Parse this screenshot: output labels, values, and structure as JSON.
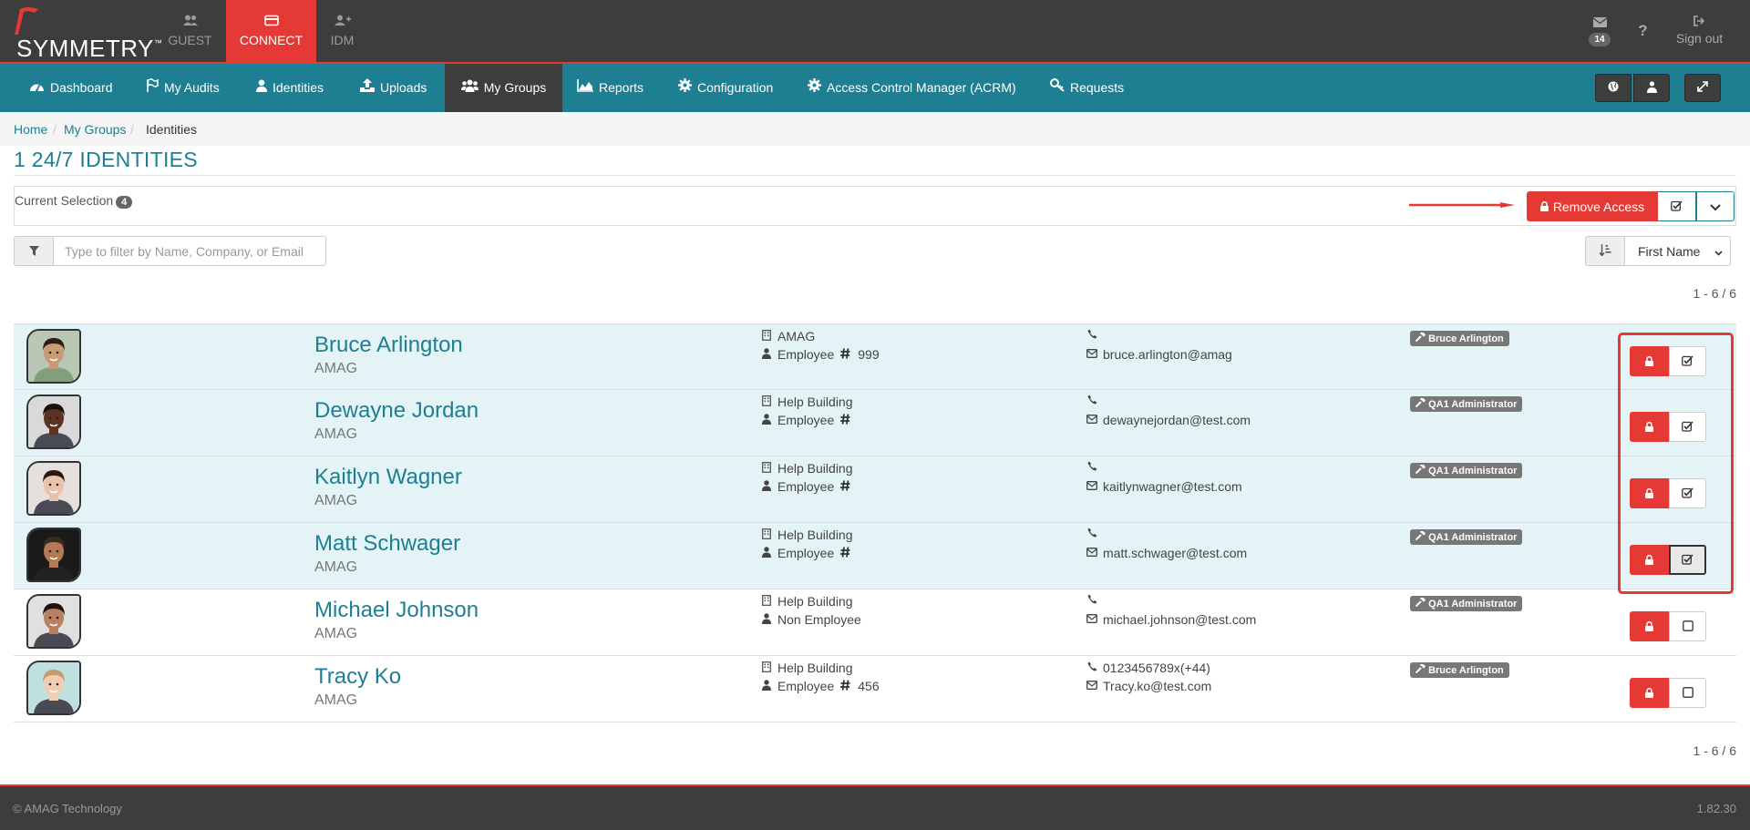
{
  "brand": {
    "name": "SYMMETRY",
    "trademark": "™"
  },
  "app_tabs": [
    {
      "label": "GUEST",
      "icon": "users-icon"
    },
    {
      "label": "CONNECT",
      "icon": "card-icon",
      "active": true
    },
    {
      "label": "IDM",
      "icon": "user-plus-icon"
    }
  ],
  "top_right": {
    "mail_count": "14",
    "help": "?",
    "sign_out": "Sign out"
  },
  "nav": [
    {
      "label": "Dashboard",
      "icon": "dashboard-icon"
    },
    {
      "label": "My Audits",
      "icon": "flag-icon"
    },
    {
      "label": "Identities",
      "icon": "user-icon"
    },
    {
      "label": "Uploads",
      "icon": "upload-icon"
    },
    {
      "label": "My Groups",
      "icon": "users-icon",
      "active": true
    },
    {
      "label": "Reports",
      "icon": "area-chart-icon"
    },
    {
      "label": "Configuration",
      "icon": "gear-icon"
    },
    {
      "label": "Access Control Manager (ACRM)",
      "icon": "gear-icon"
    },
    {
      "label": "Requests",
      "icon": "key-icon"
    }
  ],
  "breadcrumb": [
    "Home",
    "My Groups",
    "Identities"
  ],
  "page_title": "1 24/7 IDENTITIES",
  "selection": {
    "label": "Current Selection",
    "count": "4",
    "remove_label": "Remove Access"
  },
  "filter": {
    "placeholder": "Type to filter by Name, Company, or Email"
  },
  "sort": {
    "value": "First Name"
  },
  "pager": "1 - 6 / 6",
  "identities": [
    {
      "name": "Bruce Arlington",
      "company": "AMAG",
      "building": "AMAG",
      "employee_type": "Employee",
      "employee_no": "999",
      "phone": "",
      "email": "bruce.arlington@amag",
      "role": "Bruce Arlington",
      "selected": true,
      "skin": "#c89a76",
      "hair": "#2b1d14",
      "bg": "#b9c7b5"
    },
    {
      "name": "Dewayne Jordan",
      "company": "AMAG",
      "building": "Help Building",
      "employee_type": "Employee",
      "employee_no": "",
      "phone": "",
      "email": "dewaynejordan@test.com",
      "role": "QA1 Administrator",
      "selected": true,
      "skin": "#5a3420",
      "hair": "#1a100a",
      "bg": "#d9d9d9"
    },
    {
      "name": "Kaitlyn Wagner",
      "company": "AMAG",
      "building": "Help Building",
      "employee_type": "Employee",
      "employee_no": "",
      "phone": "",
      "email": "kaitlynwagner@test.com",
      "role": "QA1 Administrator",
      "selected": true,
      "skin": "#e8c2ad",
      "hair": "#2a1712",
      "bg": "#e6e0dc"
    },
    {
      "name": "Matt Schwager",
      "company": "AMAG",
      "building": "Help Building",
      "employee_type": "Employee",
      "employee_no": "",
      "phone": "",
      "email": "matt.schwager@test.com",
      "role": "QA1 Administrator",
      "selected": true,
      "pressed": true,
      "skin": "#b57a55",
      "hair": "#3a2a20",
      "bg": "#1a1a1a"
    },
    {
      "name": "Michael Johnson",
      "company": "AMAG",
      "building": "Help Building",
      "employee_type": "Non Employee",
      "employee_no": "",
      "phone": "",
      "email": "michael.johnson@test.com",
      "role": "QA1 Administrator",
      "selected": false,
      "skin": "#b88060",
      "hair": "#1c140e",
      "bg": "#e0e0e0"
    },
    {
      "name": "Tracy Ko",
      "company": "AMAG",
      "building": "Help Building",
      "employee_type": "Employee",
      "employee_no": "456",
      "phone": "0123456789x(+44)",
      "email": "Tracy.ko@test.com",
      "role": "Bruce Arlington",
      "selected": false,
      "skin": "#f0cdb0",
      "hair": "#c49a6c",
      "bg": "#bfe0e0"
    }
  ],
  "footer": {
    "copyright": "© AMAG Technology",
    "version": "1.82.30"
  },
  "colors": {
    "brand_red": "#e53935",
    "teal": "#1e7f93",
    "dark": "#3d3d3d",
    "selected_row": "#e3f3f6"
  }
}
